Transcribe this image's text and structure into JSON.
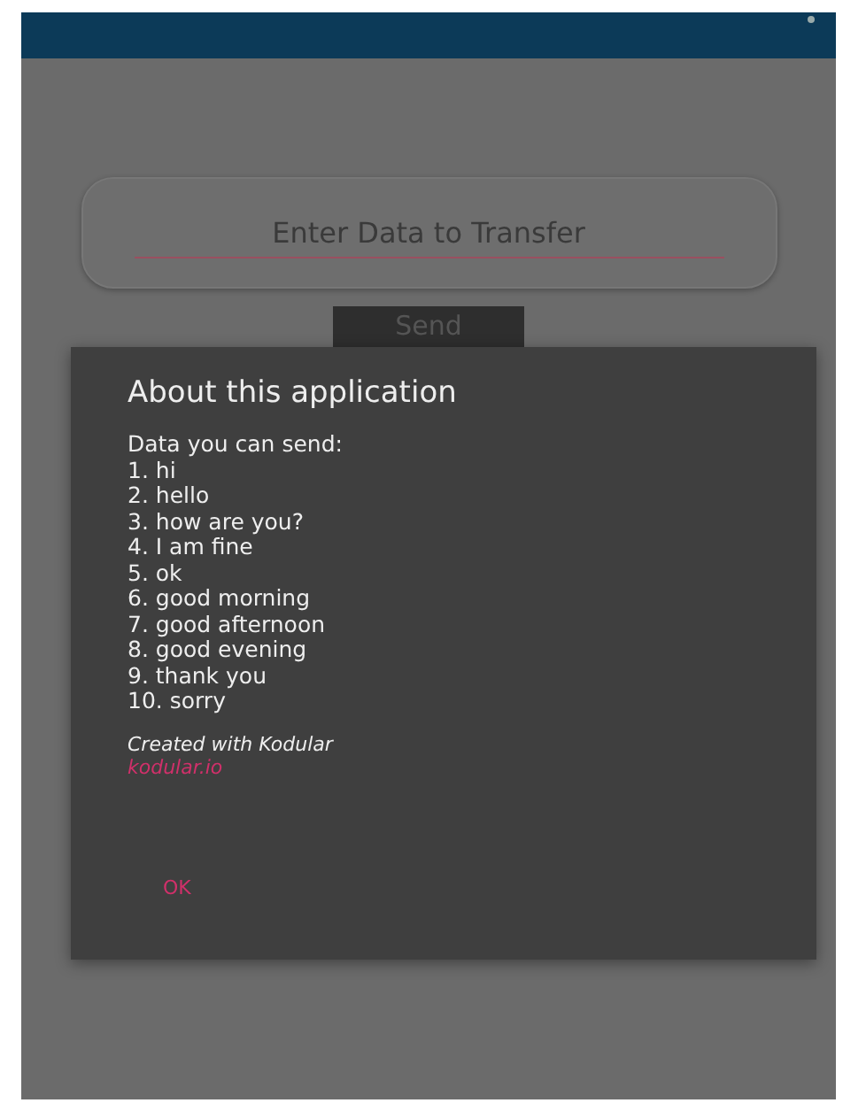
{
  "input": {
    "placeholder": "Enter Data to Transfer"
  },
  "send_button": {
    "label": "Send"
  },
  "dialog": {
    "title": "About this application",
    "intro": "Data you can send:",
    "items": [
      "1. hi",
      "2. hello",
      "3. how are you?",
      "4. I am fine",
      "5. ok",
      "6. good morning",
      "7. good afternoon",
      "8. good evening",
      "9. thank you",
      "10. sorry"
    ],
    "credit": "Created with Kodular",
    "link": "kodular.io",
    "button": "OK"
  }
}
